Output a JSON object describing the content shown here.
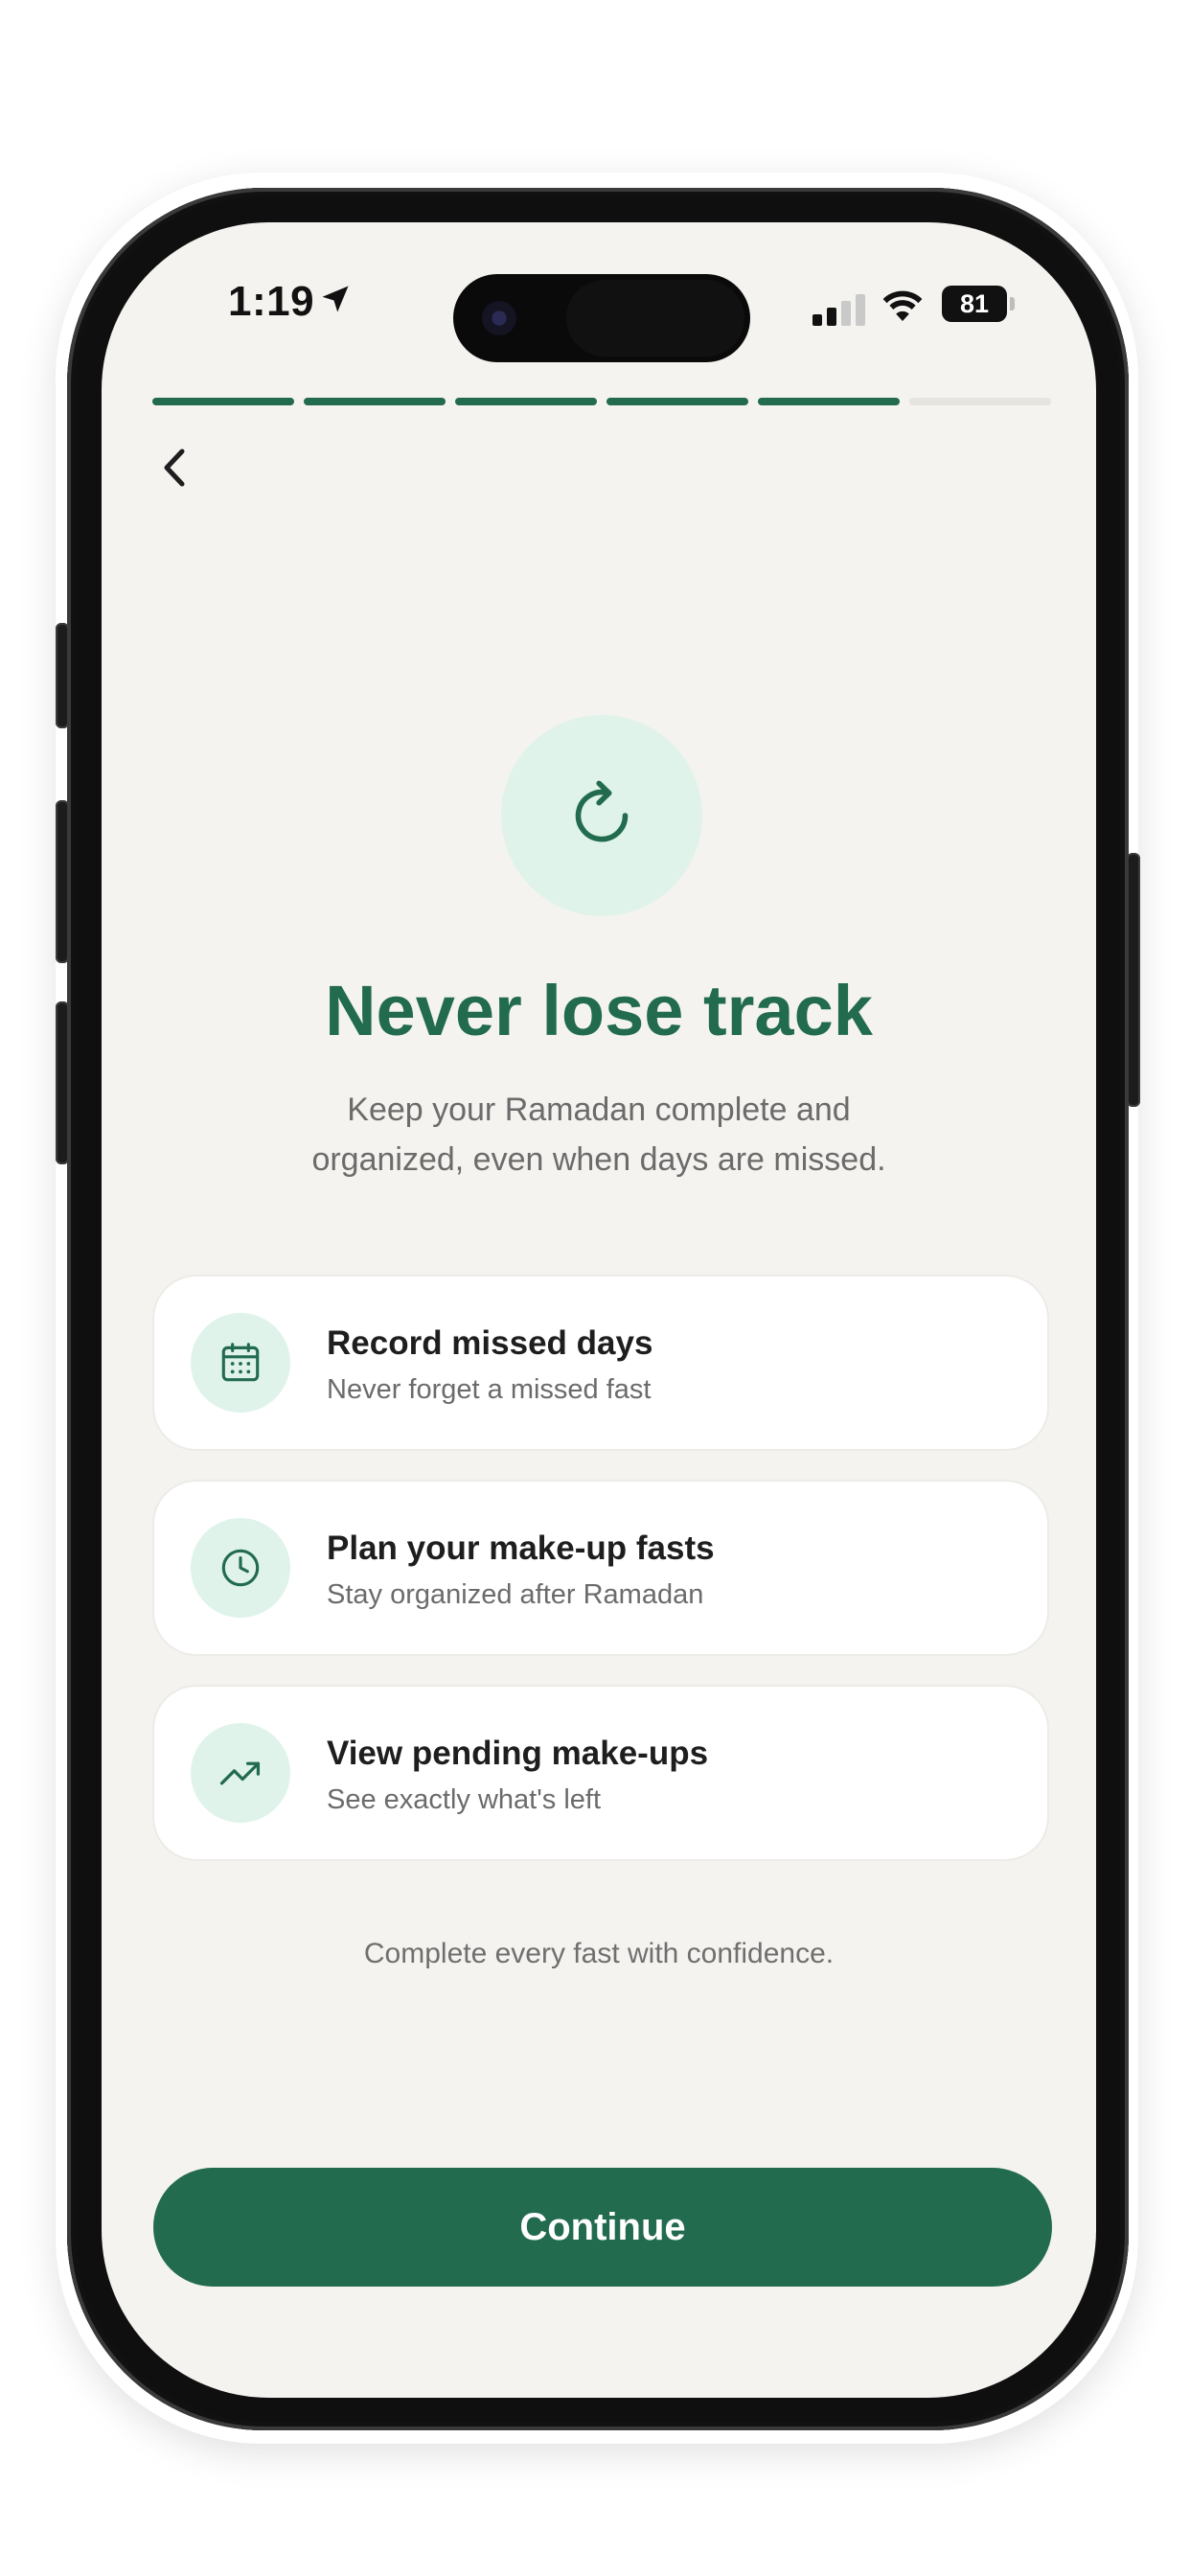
{
  "status_bar": {
    "time": "1:19",
    "battery": "81"
  },
  "onboarding": {
    "progress": {
      "total_steps": 6,
      "completed_steps": 5
    },
    "title": "Never lose track",
    "subtitle": "Keep your Ramadan complete and organized, even when days are missed.",
    "features": [
      {
        "icon": "calendar-icon",
        "title": "Record missed days",
        "subtitle": "Never forget a missed fast"
      },
      {
        "icon": "clock-icon",
        "title": "Plan your make-up fasts",
        "subtitle": "Stay organized after Ramadan"
      },
      {
        "icon": "trending-up-icon",
        "title": "View pending make-ups",
        "subtitle": "See exactly what's left"
      }
    ],
    "footnote": "Complete every fast with confidence.",
    "continue_label": "Continue"
  },
  "colors": {
    "accent": "#226b4f",
    "icon_bg": "#dff3ea",
    "screen_bg": "#f5f3ef",
    "progress_inactive": "#e6e4df"
  }
}
